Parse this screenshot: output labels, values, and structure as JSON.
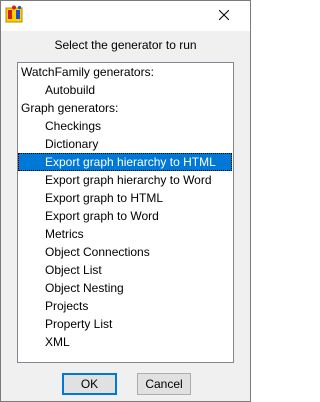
{
  "window": {
    "app_icon": "watchfamily-app-icon",
    "close_icon": "close-icon"
  },
  "dialog": {
    "prompt": "Select the generator to run"
  },
  "list": {
    "items": [
      {
        "label": "WatchFamily generators:",
        "kind": "group",
        "selected": false
      },
      {
        "label": "Autobuild",
        "kind": "child",
        "selected": false
      },
      {
        "label": "Graph generators:",
        "kind": "group",
        "selected": false
      },
      {
        "label": "Checkings",
        "kind": "child",
        "selected": false
      },
      {
        "label": "Dictionary",
        "kind": "child",
        "selected": false
      },
      {
        "label": "Export graph hierarchy to HTML",
        "kind": "child",
        "selected": true
      },
      {
        "label": "Export graph hierarchy to Word",
        "kind": "child",
        "selected": false
      },
      {
        "label": "Export graph to HTML",
        "kind": "child",
        "selected": false
      },
      {
        "label": "Export graph to Word",
        "kind": "child",
        "selected": false
      },
      {
        "label": "Metrics",
        "kind": "child",
        "selected": false
      },
      {
        "label": "Object Connections",
        "kind": "child",
        "selected": false
      },
      {
        "label": "Object List",
        "kind": "child",
        "selected": false
      },
      {
        "label": "Object Nesting",
        "kind": "child",
        "selected": false
      },
      {
        "label": "Projects",
        "kind": "child",
        "selected": false
      },
      {
        "label": "Property List",
        "kind": "child",
        "selected": false
      },
      {
        "label": "XML",
        "kind": "child",
        "selected": false
      }
    ]
  },
  "buttons": {
    "ok_label": "OK",
    "cancel_label": "Cancel"
  },
  "colors": {
    "selection": "#0078d7",
    "dialog_bg": "#f0f0f0",
    "button_bg": "#e1e1e1",
    "default_button_border": "#0078d7"
  }
}
